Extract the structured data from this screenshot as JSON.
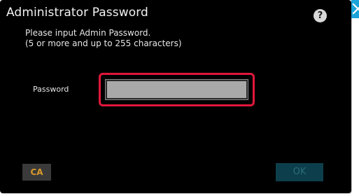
{
  "dialog": {
    "title": "Administrator Password",
    "instructions": [
      "Please input Admin Password.",
      "(5 or more and up to 255 characters)"
    ],
    "help_label": "?",
    "close_icon": "close-icon"
  },
  "password_field": {
    "label": "Password",
    "value": "",
    "highlighted": true,
    "highlight_color": "#e0173a"
  },
  "buttons": {
    "ca_label": "CA",
    "ok_label": "OK",
    "ok_enabled": false
  },
  "colors": {
    "dialog_background": "#000000",
    "input_background": "#a9a9a9",
    "ca_text": "#d99a2b",
    "ok_background": "#0c3f4b",
    "close_background": "#1aa3d9"
  }
}
